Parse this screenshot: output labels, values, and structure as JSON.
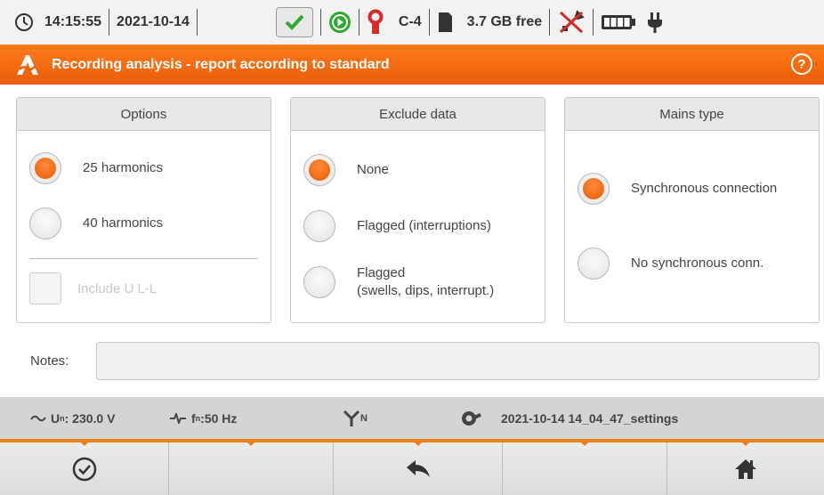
{
  "status_bar": {
    "time": "14:15:55",
    "date": "2021-10-14",
    "clamp_label": "C-4",
    "storage_free": "3.7 GB free",
    "icons": [
      "clock-icon",
      "check-icon",
      "record-play-icon",
      "clamp-icon",
      "sd-card-icon",
      "usb-disabled-icon",
      "battery-icon",
      "plug-icon"
    ]
  },
  "title_bar": {
    "title": "Recording analysis - report according to standard",
    "help_label": "?"
  },
  "panels": {
    "options": {
      "header": "Options",
      "items": [
        {
          "label": "25 harmonics",
          "selected": true
        },
        {
          "label": "40 harmonics",
          "selected": false
        }
      ],
      "checkbox_label": "Include U L-L",
      "checkbox_enabled": false
    },
    "exclude": {
      "header": "Exclude data",
      "items": [
        {
          "label": "None",
          "selected": true
        },
        {
          "label": "Flagged (interruptions)",
          "selected": false
        },
        {
          "label_line1": "Flagged",
          "label_line2": "(swells, dips, interrupt.)",
          "selected": false
        }
      ]
    },
    "mains": {
      "header": "Mains type",
      "items": [
        {
          "label": "Synchronous connection",
          "selected": true
        },
        {
          "label": "No synchronous conn.",
          "selected": false
        }
      ]
    }
  },
  "notes": {
    "label": "Notes:",
    "value": ""
  },
  "info_bar": {
    "voltage": "U",
    "voltage_sub": "n",
    "voltage_value": ": 230.0 V",
    "frequency": "f",
    "frequency_sub": "n",
    "frequency_value": ":50 Hz",
    "network_sub": "N",
    "settings_file": "2021-10-14 14_04_47_settings"
  },
  "bottom_bar": {
    "buttons": [
      "confirm-icon",
      "",
      "back-icon",
      "",
      "home-icon"
    ]
  },
  "colors": {
    "accent": "#f07d1b",
    "title_bar": "#e85d06",
    "status_ok": "#2fa82f"
  }
}
